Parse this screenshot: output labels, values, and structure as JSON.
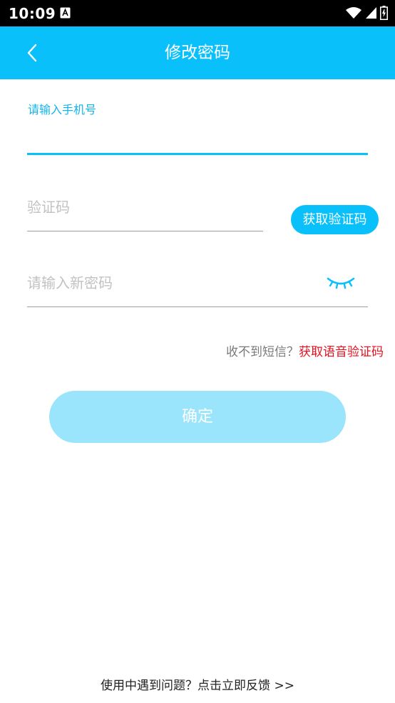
{
  "status_bar": {
    "time": "10:09"
  },
  "header": {
    "title": "修改密码"
  },
  "form": {
    "phone_label": "请输入手机号",
    "phone_value": "",
    "code_placeholder": "验证码",
    "code_value": "",
    "get_code_label": "获取验证码",
    "password_placeholder": "请输入新密码",
    "password_value": ""
  },
  "sms_help": {
    "question": "收不到短信？",
    "voice_link": "获取语音验证码"
  },
  "confirm_label": "确定",
  "footer": {
    "feedback_text": "使用中遇到问题？点击立即反馈 >>"
  },
  "colors": {
    "accent": "#0ac0fb",
    "button_disabled": "#9ae4fc",
    "link_red": "#e8101d",
    "placeholder": "#c2c2c2"
  },
  "icons": [
    "back-arrow-icon",
    "eye-closed-icon",
    "wifi-icon",
    "signal-icon",
    "battery-icon",
    "app-notification-icon"
  ]
}
